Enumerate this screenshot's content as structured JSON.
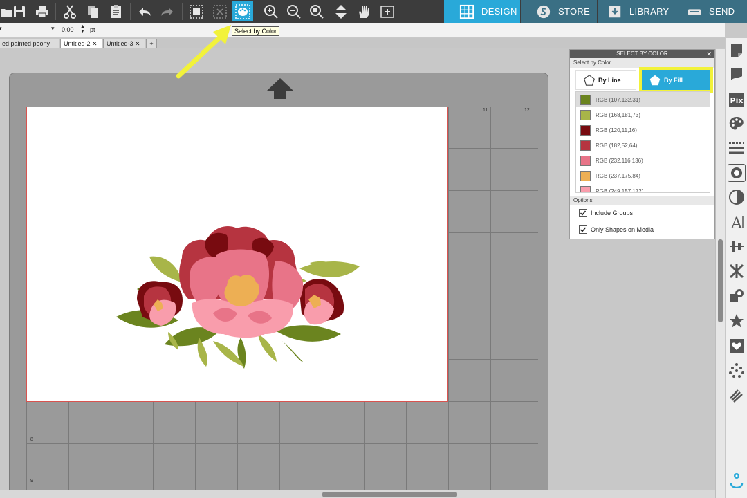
{
  "toolbar": {
    "tooltip": "Select by Color",
    "buttons": [
      "save-icon",
      "print-icon",
      "cut-icon",
      "copy-icon",
      "paste-icon",
      "undo-icon",
      "redo-icon",
      "group-icon",
      "ungroup-icon",
      "select-by-color-icon",
      "zoom-in-icon",
      "zoom-out-icon",
      "zoom-fit-icon",
      "move-down-icon",
      "pan-hand-icon",
      "add-page-icon"
    ],
    "nav": {
      "design": "DESIGN",
      "store": "STORE",
      "library": "LIBRARY",
      "send": "SEND"
    },
    "colors": {
      "bar": "#3c3c3c",
      "accent": "#29a9d9",
      "tab": "#3a6f84"
    }
  },
  "linebar": {
    "width_value": "0.00",
    "unit": "pt"
  },
  "tabs": [
    {
      "label": "ed painted peony",
      "active": false
    },
    {
      "label": "Untitled-2",
      "active": true
    },
    {
      "label": "Untitled-3",
      "active": false
    },
    {
      "label": "+",
      "active": false
    }
  ],
  "canvas": {
    "ruler_top": [
      "11",
      "12"
    ],
    "ruler_left": [
      "8",
      "9"
    ],
    "page_color": "#ffffff",
    "page_border": "#d9534f"
  },
  "panel": {
    "title": "SELECT BY COLOR",
    "subtitle": "Select by Color",
    "by_line_label": "By Line",
    "by_fill_label": "By Fill",
    "colors": [
      {
        "label": "RGB (107,132,31)",
        "hex": "#6b841f",
        "selected": true
      },
      {
        "label": "RGB (168,181,73)",
        "hex": "#a8b549",
        "selected": false
      },
      {
        "label": "RGB (120,11,16)",
        "hex": "#780b10",
        "selected": false
      },
      {
        "label": "RGB (182,52,64)",
        "hex": "#b63440",
        "selected": false
      },
      {
        "label": "RGB (232,116,136)",
        "hex": "#e87488",
        "selected": false
      },
      {
        "label": "RGB (237,175,84)",
        "hex": "#edaf54",
        "selected": false
      },
      {
        "label": "RGB (249,157,172)",
        "hex": "#f99dac",
        "selected": false
      }
    ],
    "options_label": "Options",
    "options": [
      {
        "label": "Include Groups",
        "checked": true
      },
      {
        "label": "Only Shapes on Media",
        "checked": true
      }
    ],
    "highlight_color": "#f2f23a"
  },
  "sidebar_icons": [
    "page-setup-icon",
    "media-icon",
    "pixscan-icon",
    "fill-color-icon",
    "line-style-icon",
    "offset-icon",
    "trace-icon",
    "text-style-icon",
    "align-icon",
    "replicate-icon",
    "modify-icon",
    "transform-icon",
    "sketch-icon",
    "library-icon",
    "rhinestone-icon",
    "effects-icon",
    "settings-icon"
  ]
}
